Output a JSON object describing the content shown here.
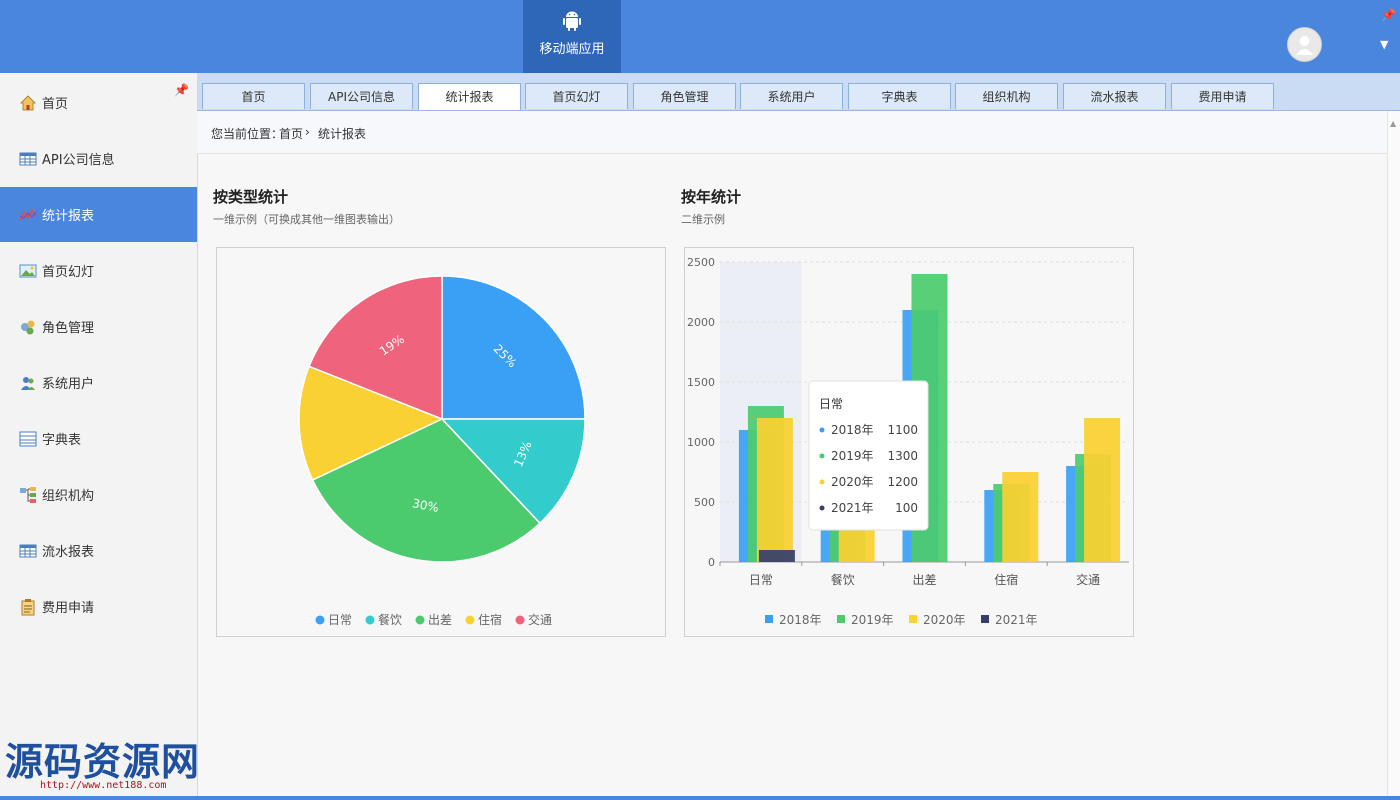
{
  "header": {
    "app_button_label": "移动端应用"
  },
  "sidebar": {
    "items": [
      {
        "label": "首页"
      },
      {
        "label": "API公司信息"
      },
      {
        "label": "统计报表"
      },
      {
        "label": "首页幻灯"
      },
      {
        "label": "角色管理"
      },
      {
        "label": "系统用户"
      },
      {
        "label": "字典表"
      },
      {
        "label": "组织机构"
      },
      {
        "label": "流水报表"
      },
      {
        "label": "费用申请"
      }
    ],
    "active_index": 2
  },
  "tabs": [
    {
      "label": "首页"
    },
    {
      "label": "API公司信息"
    },
    {
      "label": "统计报表"
    },
    {
      "label": "首页幻灯"
    },
    {
      "label": "角色管理"
    },
    {
      "label": "系统用户"
    },
    {
      "label": "字典表"
    },
    {
      "label": "组织机构"
    },
    {
      "label": "流水报表"
    },
    {
      "label": "费用申请"
    }
  ],
  "breadcrumb": {
    "prefix": "您当前位置：",
    "home": "首页",
    "separator": "›",
    "current": "统计报表"
  },
  "sections": {
    "by_type": {
      "title": "按类型统计",
      "subtitle": "一维示例（可换成其他一维图表输出）"
    },
    "by_year": {
      "title": "按年统计",
      "subtitle": "二维示例"
    }
  },
  "watermark": {
    "text": "源码资源网",
    "url": "http://www.net188.com"
  },
  "colors": {
    "accent": "#4a86de",
    "blue": "#3aa0f5",
    "teal": "#33cccc",
    "green": "#4ccb6e",
    "yellow": "#f9d132",
    "red": "#f0637c",
    "navy": "#363f6b"
  },
  "chart_data": [
    {
      "type": "pie",
      "categories": [
        "日常",
        "餐饮",
        "出差",
        "住宿",
        "交通"
      ],
      "values": [
        25,
        13,
        30,
        13,
        19
      ],
      "labels": [
        "25%",
        "13%",
        "30%",
        "",
        "19%"
      ],
      "colors": [
        "#3aa0f5",
        "#33cccc",
        "#4ccb6e",
        "#f9d132",
        "#f0637c"
      ],
      "legend": "bottom"
    },
    {
      "type": "bar",
      "categories": [
        "日常",
        "餐饮",
        "出差",
        "住宿",
        "交通"
      ],
      "series": [
        {
          "name": "2018年",
          "values": [
            1100,
            550,
            2100,
            600,
            800
          ],
          "color": "#3aa0f5"
        },
        {
          "name": "2019年",
          "values": [
            1300,
            600,
            2400,
            650,
            900
          ],
          "color": "#4ccb6e"
        },
        {
          "name": "2020年",
          "values": [
            1200,
            750,
            0,
            750,
            1200
          ],
          "color": "#f9d132"
        },
        {
          "name": "2021年",
          "values": [
            100,
            0,
            0,
            0,
            0
          ],
          "color": "#363f6b"
        }
      ],
      "ylim": [
        0,
        2500
      ],
      "yticks": [
        0,
        500,
        1000,
        1500,
        2000,
        2500
      ],
      "grid": true,
      "legend": "bottom",
      "tooltip": {
        "title": "日常",
        "rows": [
          {
            "name": "2018年",
            "value": "1100"
          },
          {
            "name": "2019年",
            "value": "1300"
          },
          {
            "name": "2020年",
            "value": "1200"
          },
          {
            "name": "2021年",
            "value": "100"
          }
        ]
      }
    }
  ]
}
